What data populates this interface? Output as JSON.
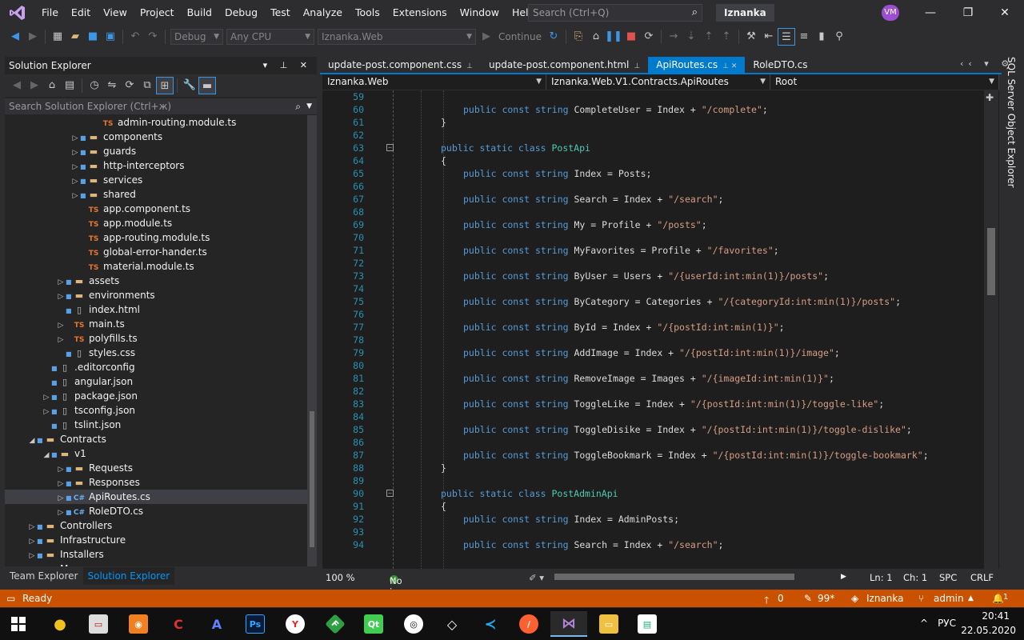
{
  "menubar": {
    "items": [
      "File",
      "Edit",
      "View",
      "Project",
      "Build",
      "Debug",
      "Test",
      "Analyze",
      "Tools",
      "Extensions",
      "Window",
      "Help"
    ],
    "search_placeholder": "Search (Ctrl+Q)",
    "solution_name": "Iznanka",
    "user_initials": "VM"
  },
  "toolbar": {
    "config": "Debug",
    "platform": "Any CPU",
    "startup_project": "Iznanka.Web",
    "continue_label": "Continue"
  },
  "solution_explorer": {
    "title": "Solution Explorer",
    "search_placeholder": "Search Solution Explorer (Ctrl+ж)",
    "tree": [
      {
        "label": "admin-routing.module.ts",
        "icon": "ts",
        "depth": 6,
        "expander": "",
        "lock": false
      },
      {
        "label": "components",
        "icon": "folder",
        "depth": 5,
        "expander": "collapsed",
        "lock": true
      },
      {
        "label": "guards",
        "icon": "folder",
        "depth": 5,
        "expander": "collapsed",
        "lock": true
      },
      {
        "label": "http-interceptors",
        "icon": "folder",
        "depth": 5,
        "expander": "collapsed",
        "lock": true
      },
      {
        "label": "services",
        "icon": "folder",
        "depth": 5,
        "expander": "collapsed",
        "lock": true
      },
      {
        "label": "shared",
        "icon": "folder",
        "depth": 5,
        "expander": "collapsed",
        "lock": true
      },
      {
        "label": "app.component.ts",
        "icon": "ts",
        "depth": 5,
        "expander": "",
        "lock": false
      },
      {
        "label": "app.module.ts",
        "icon": "ts",
        "depth": 5,
        "expander": "",
        "lock": false
      },
      {
        "label": "app-routing.module.ts",
        "icon": "ts",
        "depth": 5,
        "expander": "",
        "lock": false
      },
      {
        "label": "global-error-hander.ts",
        "icon": "ts",
        "depth": 5,
        "expander": "",
        "lock": false
      },
      {
        "label": "material.module.ts",
        "icon": "ts",
        "depth": 5,
        "expander": "",
        "lock": false
      },
      {
        "label": "assets",
        "icon": "folder",
        "depth": 4,
        "expander": "collapsed",
        "lock": true
      },
      {
        "label": "environments",
        "icon": "folder",
        "depth": 4,
        "expander": "collapsed",
        "lock": true
      },
      {
        "label": "index.html",
        "icon": "file",
        "depth": 4,
        "expander": "",
        "lock": true
      },
      {
        "label": "main.ts",
        "icon": "ts",
        "depth": 4,
        "expander": "collapsed",
        "lock": false
      },
      {
        "label": "polyfills.ts",
        "icon": "ts",
        "depth": 4,
        "expander": "collapsed",
        "lock": false
      },
      {
        "label": "styles.css",
        "icon": "file",
        "depth": 4,
        "expander": "",
        "lock": true
      },
      {
        "label": ".editorconfig",
        "icon": "file",
        "depth": 3,
        "expander": "",
        "lock": true
      },
      {
        "label": "angular.json",
        "icon": "file",
        "depth": 3,
        "expander": "",
        "lock": true
      },
      {
        "label": "package.json",
        "icon": "file",
        "depth": 3,
        "expander": "collapsed",
        "lock": true
      },
      {
        "label": "tsconfig.json",
        "icon": "file",
        "depth": 3,
        "expander": "collapsed",
        "lock": true
      },
      {
        "label": "tslint.json",
        "icon": "file",
        "depth": 3,
        "expander": "",
        "lock": true
      },
      {
        "label": "Contracts",
        "icon": "folder",
        "depth": 2,
        "expander": "expanded",
        "lock": true
      },
      {
        "label": "v1",
        "icon": "folder",
        "depth": 3,
        "expander": "expanded",
        "lock": true
      },
      {
        "label": "Requests",
        "icon": "folder",
        "depth": 4,
        "expander": "collapsed",
        "lock": true
      },
      {
        "label": "Responses",
        "icon": "folder",
        "depth": 4,
        "expander": "collapsed",
        "lock": true
      },
      {
        "label": "ApiRoutes.cs",
        "icon": "cs",
        "depth": 4,
        "expander": "collapsed",
        "lock": true,
        "selected": true
      },
      {
        "label": "RoleDTO.cs",
        "icon": "cs",
        "depth": 4,
        "expander": "collapsed",
        "lock": true
      },
      {
        "label": "Controllers",
        "icon": "folder",
        "depth": 2,
        "expander": "collapsed",
        "lock": true
      },
      {
        "label": "Infrastructure",
        "icon": "folder",
        "depth": 2,
        "expander": "collapsed",
        "lock": true
      },
      {
        "label": "Installers",
        "icon": "folder",
        "depth": 2,
        "expander": "collapsed",
        "lock": true
      },
      {
        "label": "M...",
        "icon": "folder",
        "depth": 2,
        "expander": "collapsed",
        "lock": true
      }
    ],
    "bottom_tabs": [
      "Team Explorer",
      "Solution Explorer"
    ]
  },
  "doc_tabs": [
    {
      "label": "update-post.component.css",
      "active": false
    },
    {
      "label": "update-post.component.html",
      "active": false
    },
    {
      "label": "ApiRoutes.cs",
      "active": true
    },
    {
      "label": "RoleDTO.cs",
      "active": false
    }
  ],
  "navbar": {
    "project": "Iznanka.Web",
    "type": "Iznanka.Web.V1.Contracts.ApiRoutes",
    "member": "Root"
  },
  "code_lines": [
    {
      "n": "59",
      "indent": 0,
      "tokens": []
    },
    {
      "n": "60",
      "indent": 2,
      "tokens": [
        [
          "kw",
          "public const string "
        ],
        [
          "t",
          "CompleteUser = Index + "
        ],
        [
          "s",
          "\"/complete\""
        ],
        [
          "t",
          ";"
        ]
      ]
    },
    {
      "n": "61",
      "indent": 1,
      "tokens": [
        [
          "t",
          "}"
        ]
      ]
    },
    {
      "n": "62",
      "indent": 0,
      "tokens": []
    },
    {
      "n": "63",
      "indent": 1,
      "fold": true,
      "tokens": [
        [
          "kw",
          "public static class "
        ],
        [
          "tp",
          "PostApi"
        ]
      ]
    },
    {
      "n": "64",
      "indent": 1,
      "tokens": [
        [
          "t",
          "{"
        ]
      ]
    },
    {
      "n": "65",
      "indent": 2,
      "tokens": [
        [
          "kw",
          "public const string "
        ],
        [
          "t",
          "Index = Posts;"
        ]
      ]
    },
    {
      "n": "66",
      "indent": 0,
      "tokens": []
    },
    {
      "n": "67",
      "indent": 2,
      "tokens": [
        [
          "kw",
          "public const string "
        ],
        [
          "t",
          "Search = Index + "
        ],
        [
          "s",
          "\"/search\""
        ],
        [
          "t",
          ";"
        ]
      ]
    },
    {
      "n": "68",
      "indent": 0,
      "tokens": []
    },
    {
      "n": "69",
      "indent": 2,
      "tokens": [
        [
          "kw",
          "public const string "
        ],
        [
          "t",
          "My = Profile + "
        ],
        [
          "s",
          "\"/posts\""
        ],
        [
          "t",
          ";"
        ]
      ]
    },
    {
      "n": "70",
      "indent": 0,
      "tokens": []
    },
    {
      "n": "71",
      "indent": 2,
      "tokens": [
        [
          "kw",
          "public const string "
        ],
        [
          "t",
          "MyFavorites = Profile + "
        ],
        [
          "s",
          "\"/favorites\""
        ],
        [
          "t",
          ";"
        ]
      ]
    },
    {
      "n": "72",
      "indent": 0,
      "tokens": []
    },
    {
      "n": "73",
      "indent": 2,
      "tokens": [
        [
          "kw",
          "public const string "
        ],
        [
          "t",
          "ByUser = Users + "
        ],
        [
          "s",
          "\"/{userId:int:min(1)}/posts\""
        ],
        [
          "t",
          ";"
        ]
      ]
    },
    {
      "n": "74",
      "indent": 0,
      "tokens": []
    },
    {
      "n": "75",
      "indent": 2,
      "tokens": [
        [
          "kw",
          "public const string "
        ],
        [
          "t",
          "ByCategory = Categories + "
        ],
        [
          "s",
          "\"/{categoryId:int:min(1)}/posts\""
        ],
        [
          "t",
          ";"
        ]
      ]
    },
    {
      "n": "76",
      "indent": 0,
      "tokens": []
    },
    {
      "n": "77",
      "indent": 2,
      "tokens": [
        [
          "kw",
          "public const string "
        ],
        [
          "t",
          "ById = Index + "
        ],
        [
          "s",
          "\"/{postId:int:min(1)}\""
        ],
        [
          "t",
          ";"
        ]
      ]
    },
    {
      "n": "78",
      "indent": 0,
      "tokens": []
    },
    {
      "n": "79",
      "indent": 2,
      "tokens": [
        [
          "kw",
          "public const string "
        ],
        [
          "t",
          "AddImage = Index + "
        ],
        [
          "s",
          "\"/{postId:int:min(1)}/image\""
        ],
        [
          "t",
          ";"
        ]
      ]
    },
    {
      "n": "80",
      "indent": 0,
      "tokens": []
    },
    {
      "n": "81",
      "indent": 2,
      "tokens": [
        [
          "kw",
          "public const string "
        ],
        [
          "t",
          "RemoveImage = Images + "
        ],
        [
          "s",
          "\"/{imageId:int:min(1)}\""
        ],
        [
          "t",
          ";"
        ]
      ]
    },
    {
      "n": "82",
      "indent": 0,
      "tokens": []
    },
    {
      "n": "83",
      "indent": 2,
      "tokens": [
        [
          "kw",
          "public const string "
        ],
        [
          "t",
          "ToggleLike = Index + "
        ],
        [
          "s",
          "\"/{postId:int:min(1)}/toggle-like\""
        ],
        [
          "t",
          ";"
        ]
      ]
    },
    {
      "n": "84",
      "indent": 0,
      "tokens": []
    },
    {
      "n": "85",
      "indent": 2,
      "tokens": [
        [
          "kw",
          "public const string "
        ],
        [
          "t",
          "ToggleDisike = Index + "
        ],
        [
          "s",
          "\"/{postId:int:min(1)}/toggle-dislike\""
        ],
        [
          "t",
          ";"
        ]
      ]
    },
    {
      "n": "86",
      "indent": 0,
      "tokens": []
    },
    {
      "n": "87",
      "indent": 2,
      "tokens": [
        [
          "kw",
          "public const string "
        ],
        [
          "t",
          "ToggleBookmark = Index + "
        ],
        [
          "s",
          "\"/{postId:int:min(1)}/toggle-bookmark\""
        ],
        [
          "t",
          ";"
        ]
      ]
    },
    {
      "n": "88",
      "indent": 1,
      "tokens": [
        [
          "t",
          "}"
        ]
      ]
    },
    {
      "n": "89",
      "indent": 0,
      "tokens": []
    },
    {
      "n": "90",
      "indent": 1,
      "fold": true,
      "tokens": [
        [
          "kw",
          "public static class "
        ],
        [
          "tp",
          "PostAdminApi"
        ]
      ]
    },
    {
      "n": "91",
      "indent": 1,
      "tokens": [
        [
          "t",
          "{"
        ]
      ]
    },
    {
      "n": "92",
      "indent": 2,
      "tokens": [
        [
          "kw",
          "public const string "
        ],
        [
          "t",
          "Index = AdminPosts;"
        ]
      ]
    },
    {
      "n": "93",
      "indent": 0,
      "tokens": []
    },
    {
      "n": "94",
      "indent": 2,
      "tokens": [
        [
          "kw",
          "public const string "
        ],
        [
          "t",
          "Search = Index + "
        ],
        [
          "s",
          "\"/search\""
        ],
        [
          "t",
          ";"
        ]
      ]
    }
  ],
  "editor_status": {
    "zoom": "100 %",
    "issues": "No issues found",
    "line": "Ln: 1",
    "col": "Ch: 1",
    "whitespace": "SPC",
    "eol": "CRLF"
  },
  "side_panel": {
    "label": "SQL Server Object Explorer"
  },
  "statusbar": {
    "state": "Ready",
    "up_count": "0",
    "pencil_count": "99*",
    "repo": "Iznanka",
    "branch": "admin",
    "notifications": "1"
  },
  "taskbar": {
    "lang": "РУС",
    "time": "20:41",
    "date": "22.05.2020"
  },
  "colors": {
    "accent": "#007acc",
    "statusbar": "#ca5100",
    "keyword": "#569cd6",
    "type": "#4ec9b0",
    "string": "#d69d85",
    "line_number": "#2b91af"
  }
}
